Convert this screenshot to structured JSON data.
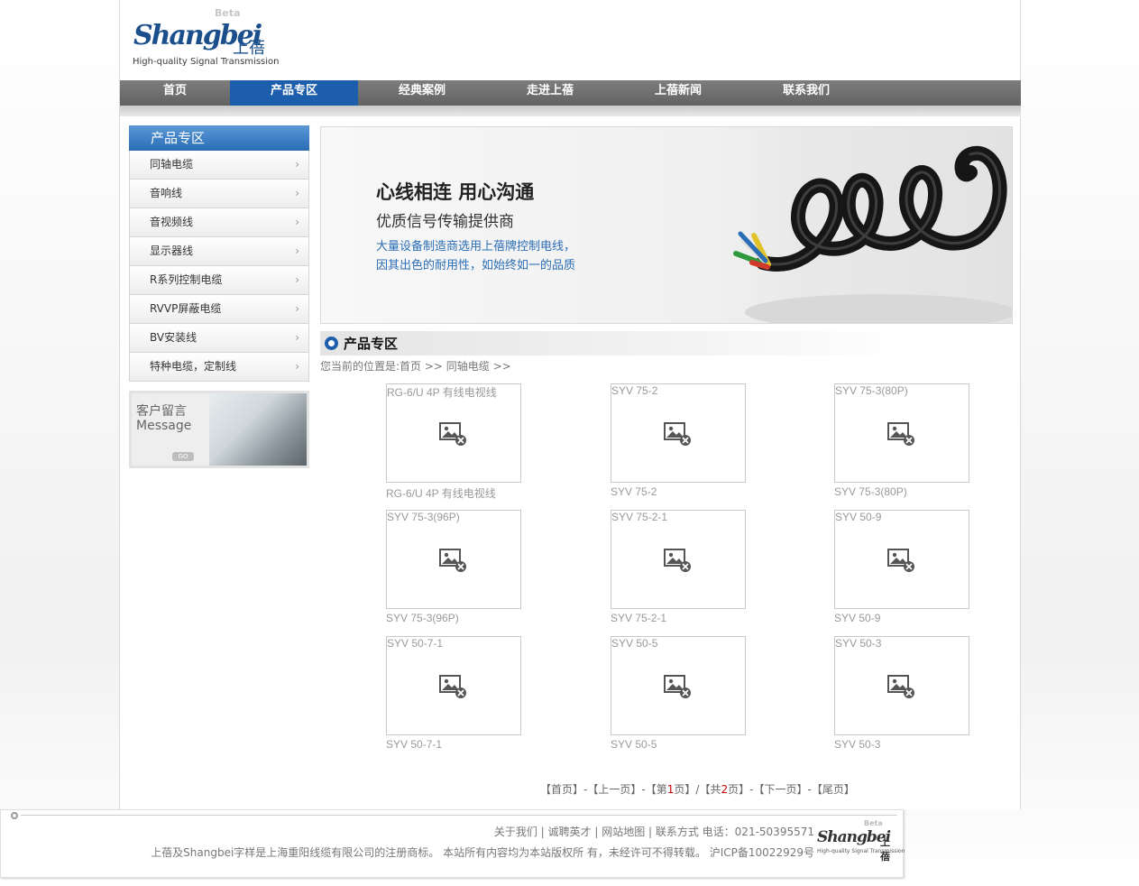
{
  "logo": {
    "beta": "Beta",
    "brand": "Shangbei",
    "brand_cn": "上蓓",
    "tagline": "High-quality Signal Transmission"
  },
  "nav": {
    "items": [
      "首页",
      "产品专区",
      "经典案例",
      "走进上蓓",
      "上蓓新闻",
      "联系我们"
    ],
    "active_index": 1,
    "active_color": "#1c5eab"
  },
  "sidebar": {
    "title": "产品专区",
    "items": [
      "同轴电缆",
      "音响线",
      "音视频线",
      "显示器线",
      "R系列控制电缆",
      "RVVP屏蔽电缆",
      "BV安装线",
      "特种电缆，定制线"
    ],
    "chevron_icon": "chevron-right-icon",
    "message_box": {
      "cn": "客户留言",
      "en": "Message",
      "go": "GO"
    }
  },
  "banner": {
    "headline": "心线相连 用心沟通",
    "subhead": "优质信号传输提供商",
    "line1": "大量设备制造商选用上蓓牌控制电线，",
    "line2": "因其出色的耐用性，如始终如一的品质"
  },
  "section": {
    "title": "产品专区",
    "breadcrumb": "您当前的位置是:首页 >> 同轴电缆 >>"
  },
  "products": [
    {
      "name": "RG-6/U 4P 有线电视线"
    },
    {
      "name": "SYV 75-2"
    },
    {
      "name": "SYV 75-3(80P)"
    },
    {
      "name": "SYV 75-3(96P)"
    },
    {
      "name": "SYV 75-2-1"
    },
    {
      "name": "SYV 50-9"
    },
    {
      "name": "SYV 50-7-1"
    },
    {
      "name": "SYV 50-5"
    },
    {
      "name": "SYV 50-3"
    }
  ],
  "pager": {
    "first": "【首页】",
    "prev": "【上一页】",
    "current_pre": "【第",
    "current": "1",
    "current_post": "页】",
    "sep": "/",
    "total_pre": "【共",
    "total": "2",
    "total_post": "页】",
    "next": "【下一页】",
    "last": "【尾页】",
    "dash": "-"
  },
  "footer": {
    "links": "关于我们 | 诚聘英才 | 网站地图 | 联系方式 电话：021-50395571",
    "copyright": "上蓓及Shangbei字样是上海重阳线缆有限公司的注册商标。 本站所有内容均为本站版权所 有，未经许可不得转载。 沪ICP备10022929号",
    "logo_beta": "Beta",
    "logo_brand": "Shangbei",
    "logo_cn": "上蓓",
    "logo_tagline": "High-quality Signal Transmission"
  }
}
